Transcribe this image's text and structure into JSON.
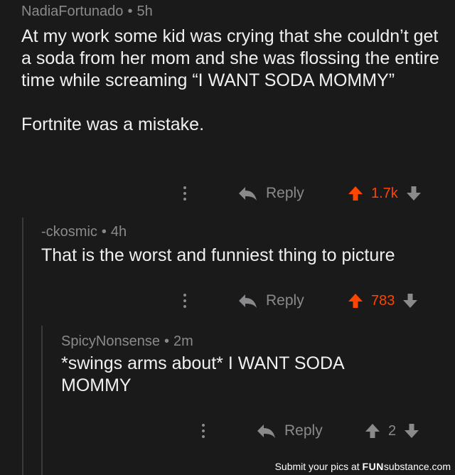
{
  "colors": {
    "background": "#1a1a1b",
    "upvote_active": "#ff4500",
    "muted": "#8a8a8c"
  },
  "comments": [
    {
      "author": "NadiaFortunado",
      "separator": "•",
      "age": "5h",
      "paragraphs": [
        "At my work some kid was crying that she couldn’t get a soda from her mom and she was flossing the entire time while screaming  “I WANT SODA MOMMY”",
        "Fortnite was a mistake."
      ],
      "reply_label": "Reply",
      "score": "1.7k",
      "upvoted": true,
      "more_icon": "vertical-ellipsis-icon"
    },
    {
      "author": "-ckosmic",
      "separator": "•",
      "age": "4h",
      "paragraphs": [
        "That is the worst and funniest thing to picture"
      ],
      "reply_label": "Reply",
      "score": "783",
      "upvoted": true,
      "more_icon": "vertical-ellipsis-icon"
    },
    {
      "author": "SpicyNonsense",
      "separator": "•",
      "age": "2m",
      "paragraphs": [
        "*swings arms about* I WANT SODA MOMMY"
      ],
      "reply_label": "Reply",
      "score": "2",
      "upvoted": false,
      "more_icon": "vertical-ellipsis-icon"
    }
  ],
  "footer": {
    "prefix": "Submit your pics at",
    "brand_bold": "FUN",
    "brand_rest": "substance",
    "suffix": ".com"
  }
}
